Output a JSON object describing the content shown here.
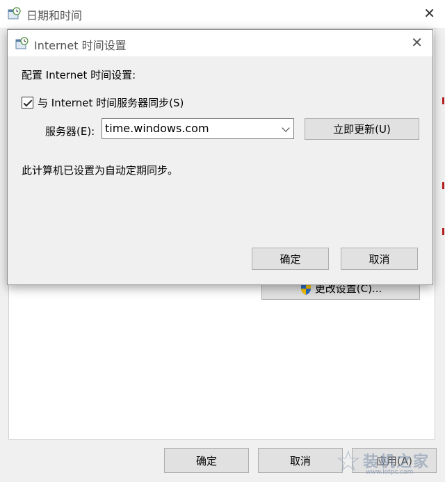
{
  "outer_window": {
    "title": "日期和时间",
    "close_glyph": "✕",
    "change_settings_label": "更改设置(C)...",
    "ok_label": "确定",
    "cancel_label": "取消",
    "apply_label": "应用(A)"
  },
  "dialog": {
    "title": "Internet 时间设置",
    "close_glyph": "✕",
    "heading": "配置 Internet 时间设置:",
    "sync_checkbox_label": "与 Internet 时间服务器同步(S)",
    "sync_checked": true,
    "server_label": "服务器(E):",
    "server_value": "time.windows.com",
    "update_now_label": "立即更新(U)",
    "status_text": "此计算机已设置为自动定期同步。",
    "ok_label": "确定",
    "cancel_label": "取消"
  },
  "watermark": {
    "name": "装机之家",
    "url": "www.lotpc.com"
  },
  "icons": {
    "window_icon": "clock-calendar-icon",
    "shield": "uac-shield-icon",
    "dropdown": "chevron-down-icon"
  },
  "colors": {
    "dialog_bg": "#f0f0f0",
    "button_bg": "#e1e1e1",
    "button_border": "#adadad",
    "shield_blue": "#2a6cc8",
    "shield_yellow": "#f5c400"
  }
}
